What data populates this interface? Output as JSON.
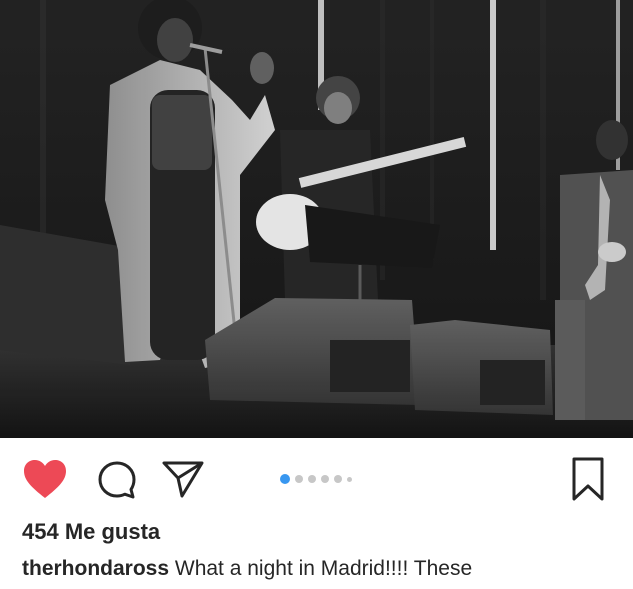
{
  "post": {
    "photo_alt": "black-and-white concert photo",
    "likes_text": "454 Me gusta",
    "username": "therhondaross",
    "caption_text": "What a night in Madrid!!!! These"
  },
  "actions": {
    "like_icon": "heart-filled-icon",
    "comment_icon": "comment-bubble-icon",
    "share_icon": "paper-plane-icon",
    "save_icon": "bookmark-icon"
  },
  "carousel": {
    "total_dots": 6,
    "active_index": 0
  },
  "colors": {
    "like_red": "#ed4956",
    "active_dot": "#3897f0",
    "inactive_dot": "#c7c7c7",
    "text": "#262626"
  }
}
